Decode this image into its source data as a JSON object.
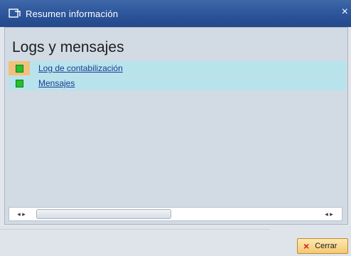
{
  "window": {
    "title": "Resumen información",
    "close_glyph": "×"
  },
  "main": {
    "heading": "Logs y mensajes",
    "rows": [
      {
        "label": "Log de contabilización",
        "status_color": "#25c02c",
        "icon": "green-status-icon"
      },
      {
        "label": "Mensajes",
        "status_color": "#25c02c",
        "icon": "green-status-icon"
      }
    ]
  },
  "scrollbar": {
    "left_arrows": "◂ ▸",
    "right_arrows": "◂ ▸"
  },
  "footer": {
    "close_label": "Cerrar",
    "close_icon": "×"
  }
}
